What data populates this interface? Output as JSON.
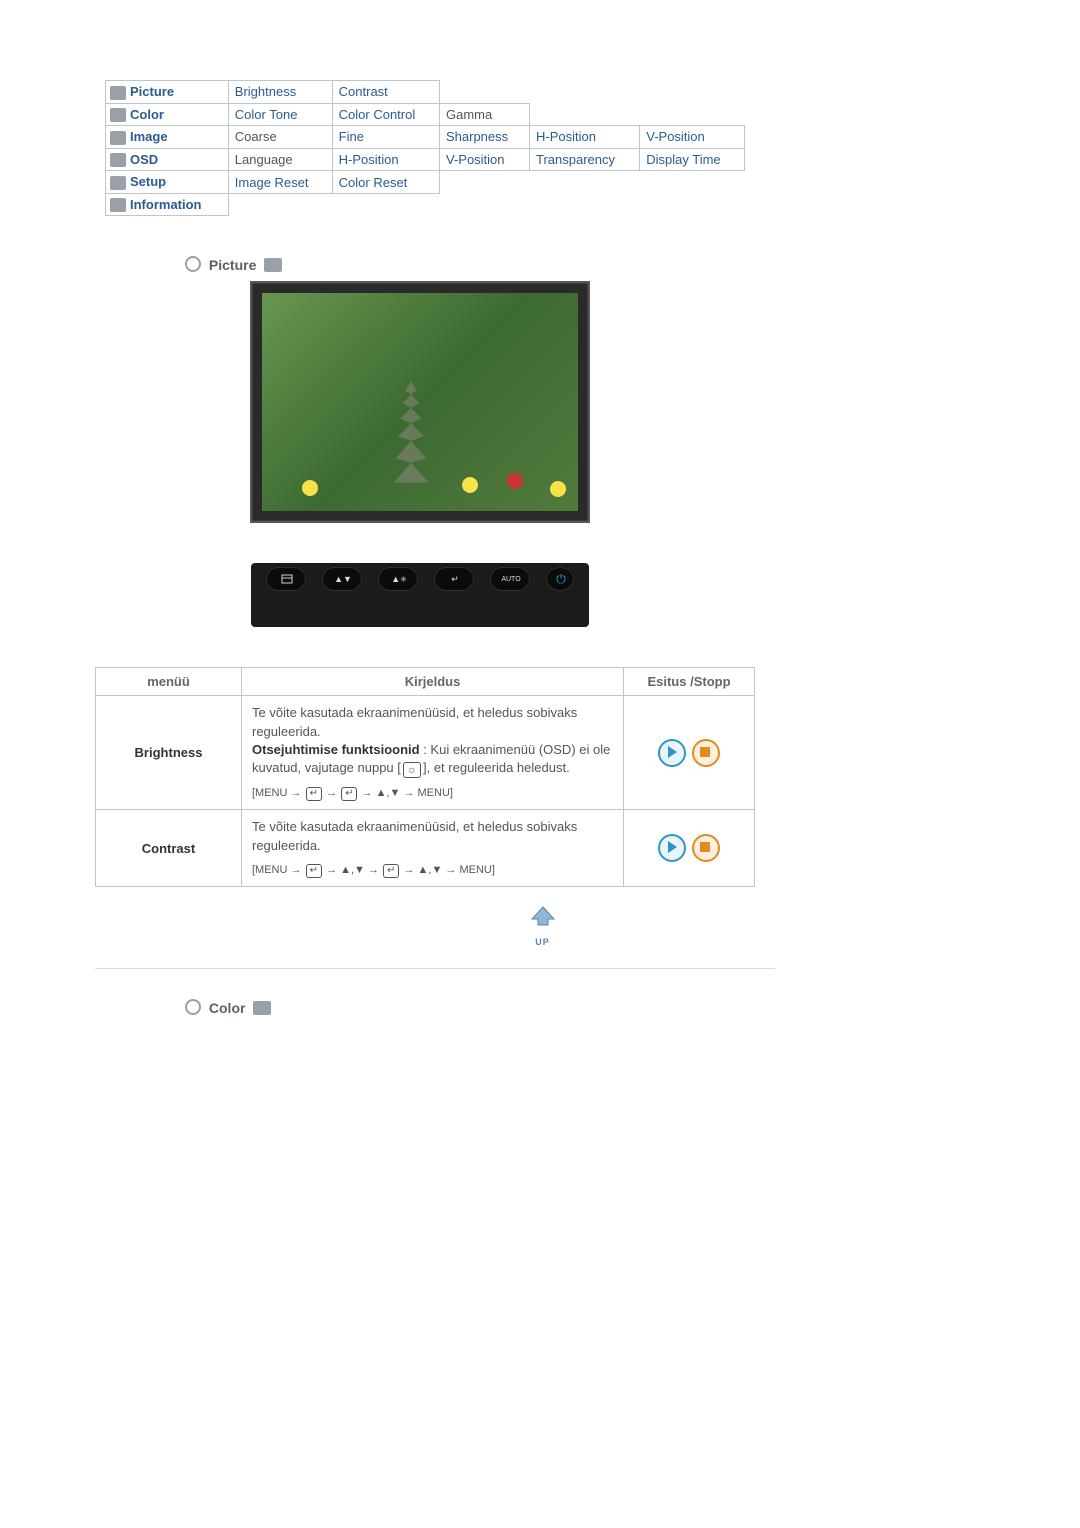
{
  "nav": {
    "picture": {
      "label": "Picture",
      "items": [
        "Brightness",
        "Contrast"
      ]
    },
    "color": {
      "label": "Color",
      "items": [
        "Color Tone",
        "Color Control",
        "Gamma"
      ]
    },
    "image": {
      "label": "Image",
      "items": [
        "Coarse",
        "Fine",
        "Sharpness",
        "H-Position",
        "V-Position"
      ]
    },
    "osd": {
      "label": "OSD",
      "items": [
        "Language",
        "H-Position",
        "V-Position",
        "Transparency",
        "Display Time"
      ]
    },
    "setup": {
      "label": "Setup",
      "items": [
        "Image Reset",
        "Color Reset"
      ]
    },
    "information": {
      "label": "Information",
      "items": []
    }
  },
  "sections": {
    "picture": "Picture",
    "color": "Color"
  },
  "buttons_bar": [
    "menu",
    "arrow-updown",
    "arrow-adjust",
    "enter",
    "AUTO",
    "power"
  ],
  "table": {
    "headers": {
      "menu": "menüü",
      "desc": "Kirjeldus",
      "play": "Esitus /Stopp"
    },
    "rows": {
      "brightness": {
        "name": "Brightness",
        "line1": "Te võite kasutada ekraanimenüüsid, et heledus sobivaks reguleerida.",
        "bold": "Otsejuhtimise funktsioonid",
        "line2_after_bold": " : Kui ekraanimenüü (OSD) ei ole kuvatud, vajutage nuppu [",
        "line2_tail": "], et reguleerida heledust.",
        "seq_prefix": "[MENU → ",
        "seq_mid": " → ",
        "seq_arrows": " → ▲,▼ → MENU]"
      },
      "contrast": {
        "name": "Contrast",
        "line1": "Te võite kasutada ekraanimenüüsid, et heledus sobivaks reguleerida.",
        "seq_prefix": "[MENU → ",
        "seq_mid1": " → ▲,▼ → ",
        "seq_mid2": " → ▲,▼ → MENU]"
      }
    }
  },
  "glyphs": {
    "enter": "↵",
    "sun": "☼",
    "auto": "AUTO",
    "power": "⏻",
    "up_label": "UP"
  }
}
